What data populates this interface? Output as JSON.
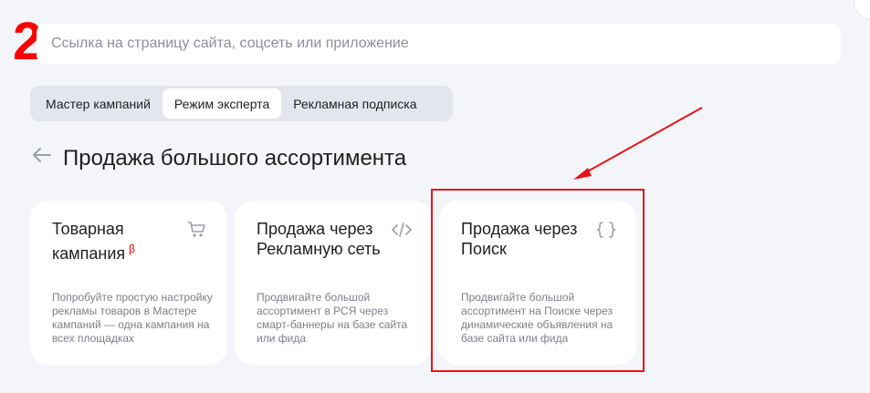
{
  "step_number": "2",
  "url_input": {
    "placeholder": "Ссылка на страницу сайта, соцсеть или приложение"
  },
  "tabs": [
    {
      "label": "Мастер кампаний",
      "active": false
    },
    {
      "label": "Режим эксперта",
      "active": true
    },
    {
      "label": "Рекламная подписка",
      "active": false
    }
  ],
  "page_title": "Продажа большого ассортимента",
  "cards": [
    {
      "title": "Товарная кампания",
      "badge": "β",
      "icon": "cart-icon",
      "description": "Попробуйте простую настройку рекламы товаров в Мастере кампаний — одна кампания на всех площадках"
    },
    {
      "title": "Продажа через Рекламную сеть",
      "icon": "code-icon",
      "description": "Продвигайте большой ассортимент в РСЯ через смарт-баннеры на базе сайта или фида"
    },
    {
      "title": "Продажа через Поиск",
      "icon": "braces-icon",
      "description": "Продвигайте большой ассортимент на Поиске через динамические объявления на базе сайта или фида"
    }
  ],
  "annotation": {
    "color": "#e8141a",
    "highlighted_card": "Продажа через Поиск"
  }
}
